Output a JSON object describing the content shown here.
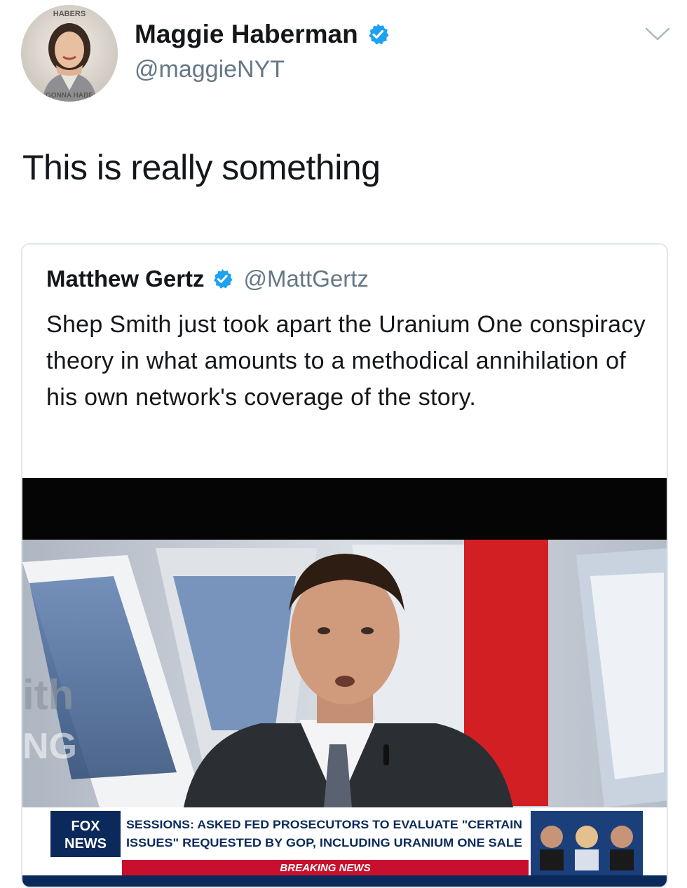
{
  "tweet": {
    "author": {
      "name": "Maggie Haberman",
      "handle": "@maggieNYT",
      "verified": true,
      "avatar_ring_text_top": "HABERS",
      "avatar_ring_text_bottom": "GONNA HABE"
    },
    "text": "This is really something",
    "menu_icon": "chevron-down-icon"
  },
  "quoted": {
    "name": "Matthew Gertz",
    "handle": "@MattGertz",
    "verified": true,
    "text": "Shep Smith just took apart the Uranium One conspiracy theory in what amounts to a methodical annihilation of his own network's coverage of the story."
  },
  "media": {
    "network_logo_line1": "FOX",
    "network_logo_line2": "NEWS",
    "chyron_line1": "SESSIONS: ASKED FED PROSECUTORS TO EVALUATE \"CERTAIN",
    "chyron_line2": "ISSUES\" REQUESTED BY GOP, INCLUDING URANIUM ONE SALE",
    "banner": "BREAKING NEWS",
    "background_text_1": "ith",
    "background_text_2": "NG"
  },
  "colors": {
    "verified_blue": "#1da1f2",
    "secondary_text": "#657786",
    "border": "#e1e8ed",
    "fox_red": "#c8102e",
    "fox_navy": "#0b2a5b"
  }
}
